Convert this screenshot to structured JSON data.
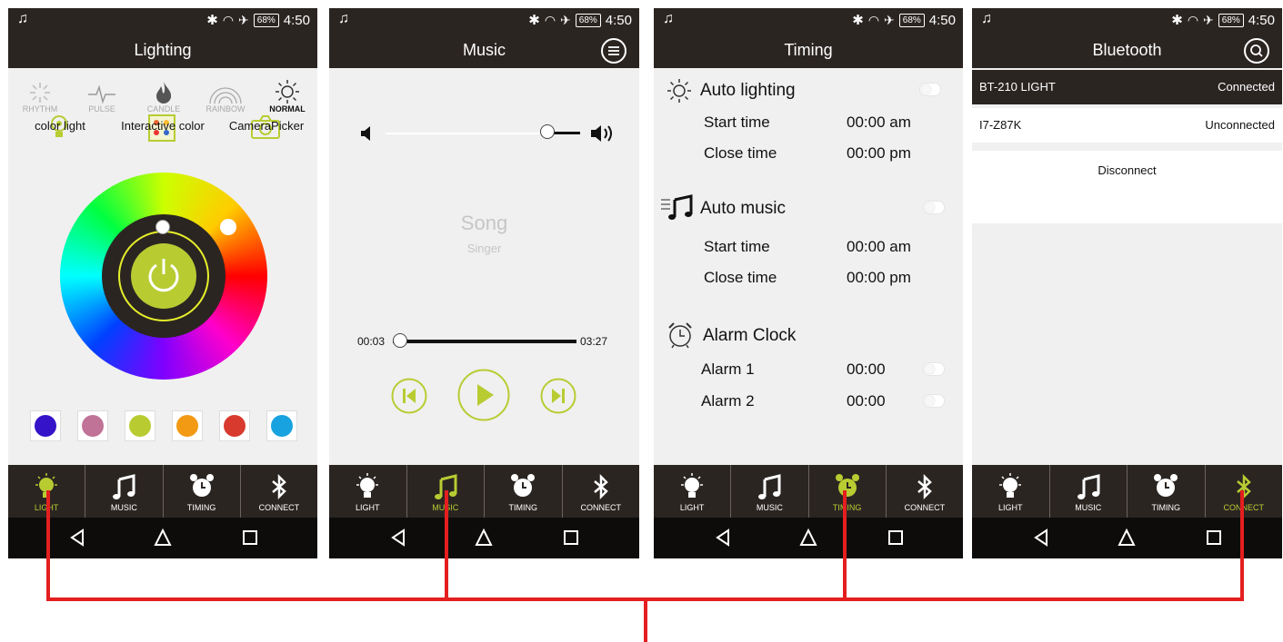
{
  "status_bar": {
    "battery": "68%",
    "time": "4:50"
  },
  "tabs": [
    {
      "label": "LIGHT",
      "icon": "bulb-icon"
    },
    {
      "label": "MUSIC",
      "icon": "music-note-icon"
    },
    {
      "label": "TIMING",
      "icon": "alarm-clock-icon"
    },
    {
      "label": "CONNECT",
      "icon": "bluetooth-icon"
    }
  ],
  "colors": {
    "accent": "#b8cc32",
    "bar": "#2b2522",
    "connector": "#e41f1f"
  },
  "lighting": {
    "title": "Lighting",
    "modes": [
      "RHYTHM",
      "PULSE",
      "CANDLE",
      "RAINBOW",
      "NORMAL"
    ],
    "selected_mode": "NORMAL",
    "sub_options": [
      "color light",
      "Interactive color",
      "CameraPicker"
    ],
    "swatches": [
      "#3413c9",
      "#c07297",
      "#b8cc32",
      "#f39a14",
      "#d83a2e",
      "#19a2e0"
    ]
  },
  "music": {
    "title": "Music",
    "song": "Song",
    "singer": "Singer",
    "current_time": "00:03",
    "total_time": "03:27"
  },
  "timing": {
    "title": "Timing",
    "auto_lighting": {
      "label": "Auto lighting",
      "start_label": "Start time",
      "start_value": "00:00 am",
      "close_label": "Close time",
      "close_value": "00:00 pm"
    },
    "auto_music": {
      "label": "Auto music",
      "start_label": "Start time",
      "start_value": "00:00 am",
      "close_label": "Close time",
      "close_value": "00:00 pm"
    },
    "alarm_clock": {
      "label": "Alarm Clock",
      "alarm1_label": "Alarm 1",
      "alarm1_value": "00:00",
      "alarm2_label": "Alarm 2",
      "alarm2_value": "00:00"
    }
  },
  "bluetooth": {
    "title": "Bluetooth",
    "devices": [
      {
        "name": "BT-210 LIGHT",
        "status": "Connected"
      },
      {
        "name": "I7-Z87K",
        "status": "Unconnected"
      }
    ],
    "disconnect_label": "Disconnect"
  }
}
